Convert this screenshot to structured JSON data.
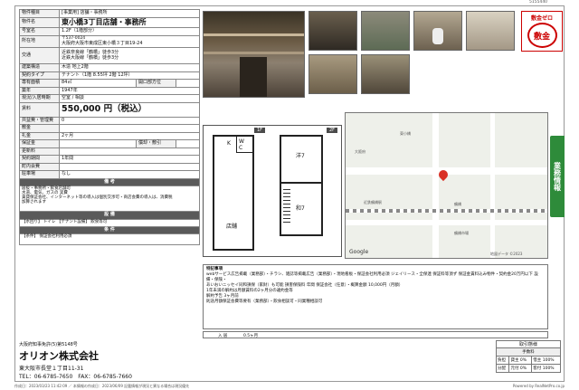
{
  "page_code": "5155440",
  "badge": {
    "text": "敷金ゼロ",
    "mark": "敷金"
  },
  "sidebar_label": "業務情報",
  "details": {
    "property_type_label": "物件種目",
    "property_type": "[事業用] 店舗・事務所",
    "name_label": "物件名",
    "name": "東小橋3丁目店舗・事務所",
    "room_label": "号室名",
    "room": "1.2F（1階部分）",
    "location_label": "所在地",
    "postal": "〒537-0024",
    "address": "大阪府大阪市東成区東小橋３丁目19-24",
    "traffic_label": "交通",
    "traffic1": "近鉄奈良線「鶴橋」徒歩3分",
    "traffic2": "近鉄大阪線「鶴橋」徒歩3分",
    "structure_label": "建築構造",
    "structure": "木造 地上2階",
    "contract_label": "契約タイプ",
    "contract": "テナント（1階 8.55坪 2階 12坪）",
    "area_label": "専有面積",
    "area": "84㎡",
    "orientation_label": "開口部方位",
    "orientation": "",
    "built_label": "築年",
    "built": "1947年",
    "current_label": "現況/入居時期",
    "current": "空室 / 相談",
    "rent_label": "賃料",
    "rent": "550,000 円（税込）",
    "common_label": "共益費・管理費",
    "common": "0",
    "deposit_label": "敷金",
    "deposit": "",
    "key_money_label": "礼金",
    "key_money": "2ヶ月",
    "guarantee_label": "保証金",
    "guarantee": "",
    "shokyaku_label": "償却・敷引",
    "shokyaku": "",
    "renewal_label": "更新料",
    "renewal": "",
    "period_label": "契約期間",
    "period": "1年間",
    "assoc_label": "町内会費",
    "assoc": "",
    "parking_label": "駐車場",
    "parking": "なし",
    "remarks_title": "備 考",
    "remarks_lines": [
      "居抜・事務所・飲食店舗可",
      "水道、電気、ガスの 実費",
      "賃貸保証会社、インターネット等の導入は個別交渉可・商店会費の導入は、消費税",
      "加算されます"
    ],
    "equip_title": "設 備",
    "equip": "【水回り】 トイレ 【テナント設備】 飲食等可",
    "cond_title": "条 件",
    "cond": "【条件】 保証会社利用必須"
  },
  "floorplan": {
    "floor1": "1F",
    "floor2": "2F",
    "shop": "店舗",
    "w": "W",
    "c": "C",
    "k": "K",
    "youshitsu": "洋7",
    "washitsu": "和7"
  },
  "map": {
    "labels": [
      "東小橋",
      "大阪府",
      "Google",
      "鶴橋",
      "近鉄鶴橋駅",
      "鶴橋市場"
    ],
    "scale": "地図データ ©2023"
  },
  "notes": {
    "title": "特記事項",
    "lines": [
      "webサービス広告掲載（業務部）・チラシ、雑誌等掲載広告（業務部）・現地看板・保証会社利用必須 ジェイリース・全保連 保証料等頂ず 保証金賃料込み物件・契約金20万円以下 設備・保険・",
      "あいおいニッセイ同和損保（家財）も可能 損害保険料 年間 保証会社（任意）・概算金額 10,000円（月額）",
      "1年未満の解約は月額賃料の2ヶ月分の違約金等",
      "解約予告 3ヶ月前",
      "則途月額保証会費等要有（業務部）・飲食相談可・同業種相談可"
    ],
    "avail_label": "入 居",
    "avail_value": "0.5ヶ月"
  },
  "company": {
    "license": "大阪府知事免許(5)第5148号",
    "name": "オリオン株式会社",
    "address": "東大阪市長堂１丁目11-31",
    "tel_fax": "TEL：06-6785-7650　FAX：06-6785-7660"
  },
  "fees": {
    "title": "取引態様",
    "subtitle": "手数料",
    "rows": [
      [
        "負担",
        "貸主 0%",
        "借主 100%"
      ],
      [
        "分配",
        "元付 0%",
        "客付 100%"
      ]
    ]
  },
  "footer": "作成日：2023/03/23 11:42:09 ／ 本情報の作成日：2023/06/09 記載情報が現況と異なる場合は現況優先",
  "powered": "Powered by RealNetPro.co.jp"
}
